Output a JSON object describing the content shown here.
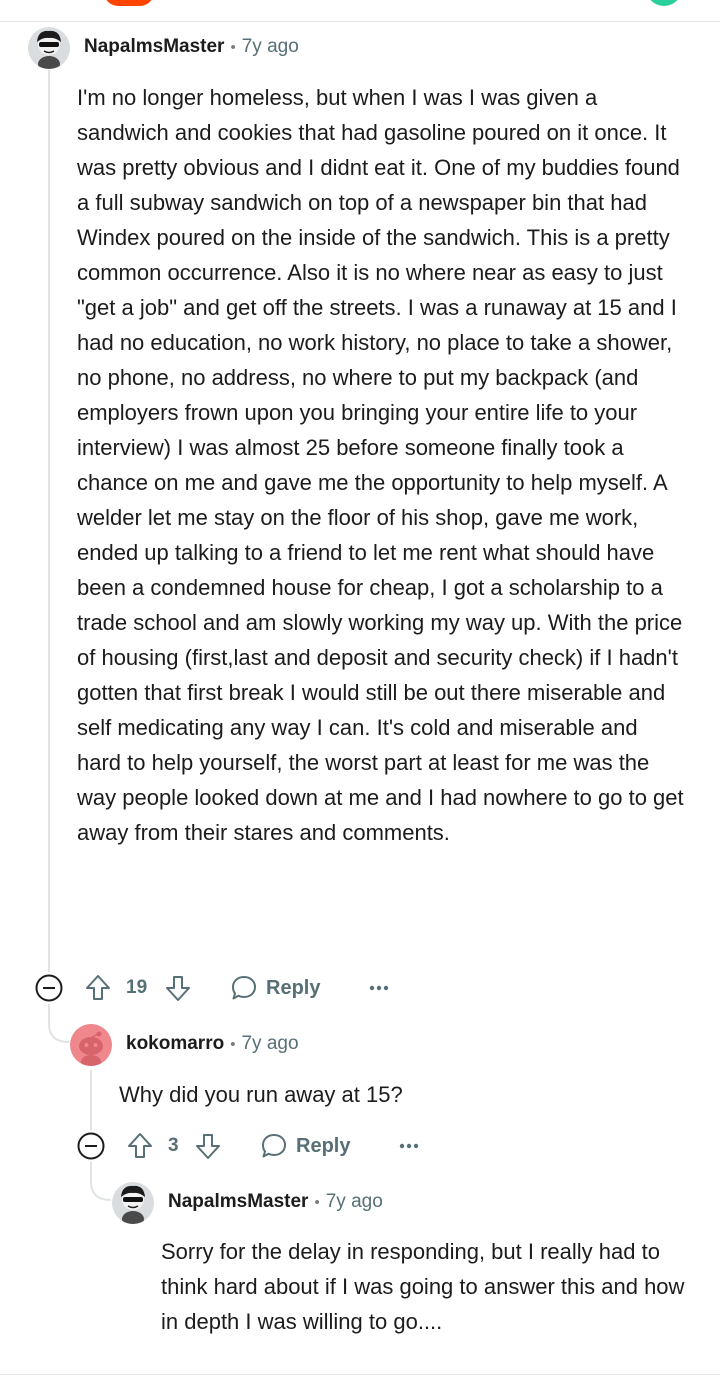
{
  "comments": [
    {
      "username": "NapalmsMaster",
      "time": "7y ago",
      "body": "I'm no longer homeless, but when I was I was given a sandwich and cookies that had gasoline poured on it once. It was pretty obvious and I didnt eat it. One of my buddies found a full subway sandwich on top of a newspaper bin that had Windex poured on the inside of the sandwich. This is a pretty common occurrence. Also it is no where near as easy to just \"get a job\" and get off the streets. I was a runaway at 15 and I had no education, no work history, no place to take a shower, no phone, no address, no where to put my backpack (and employers frown upon you bringing your entire life to your interview) I was almost 25 before someone finally took a chance on me and gave me the opportunity to help myself. A welder let me stay on the floor of his shop, gave me work, ended up talking to a friend to let me rent what should have been a condemned house for cheap, I got a scholarship to a trade school and am slowly working my way up. With the price of housing (first,last and deposit and security check) if I hadn't gotten that first break I would still be out there miserable and self medicating any way I can. It's cold and miserable and hard to help yourself, the worst part at least for me was the way people looked down at me and I had nowhere to go to get away from their stares and comments.",
      "votes": "19",
      "reply_label": "Reply"
    },
    {
      "username": "kokomarro",
      "time": "7y ago",
      "body": "Why did you run away at 15?",
      "votes": "3",
      "reply_label": "Reply"
    },
    {
      "username": "NapalmsMaster",
      "time": "7y ago",
      "body": "Sorry for the delay in responding, but I really had to think hard about if I was going to answer this and how in depth I was willing to go...."
    }
  ],
  "meta_separator": "•",
  "icons": {
    "collapse": "minus-circle-icon",
    "upvote": "arrow-up-icon",
    "downvote": "arrow-down-icon",
    "reply": "speech-bubble-icon",
    "more": "ellipsis-icon"
  },
  "colors": {
    "text": "#1c1c1c",
    "muted": "#576f76",
    "thread_line": "#e0e4e7",
    "avatar_pink": "#f0878d",
    "reddit_orange": "#ff4500"
  }
}
